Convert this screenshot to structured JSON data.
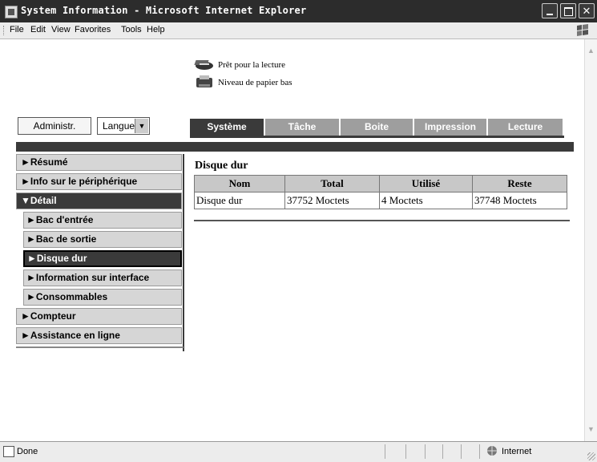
{
  "window": {
    "title": "System Information - Microsoft Internet Explorer"
  },
  "menu": [
    "File",
    "Edit",
    "View",
    "Favorites",
    "Tools",
    "Help"
  ],
  "printer_status": [
    {
      "icon": "printer-ready-icon",
      "text": "Prêt pour la lecture"
    },
    {
      "icon": "printer-low-paper-icon",
      "text": "Niveau de papier bas"
    }
  ],
  "controls": {
    "admin_button": "Administr.",
    "language_select": "Langue"
  },
  "tabs": [
    {
      "label": "Système",
      "active": true
    },
    {
      "label": "Tâche",
      "active": false
    },
    {
      "label": "Boite",
      "active": false
    },
    {
      "label": "Impression",
      "active": false
    },
    {
      "label": "Lecture",
      "active": false
    }
  ],
  "sidebar": {
    "items": [
      {
        "label": "►Résumé"
      },
      {
        "label": "►Info sur le périphérique"
      },
      {
        "label": "▼Détail"
      },
      {
        "label": "►Bac d'entrée"
      },
      {
        "label": "►Bac de sortie"
      },
      {
        "label": "►Disque dur"
      },
      {
        "label": "►Information sur interface"
      },
      {
        "label": "►Consommables"
      },
      {
        "label": "►Compteur"
      },
      {
        "label": "►Assistance en ligne"
      }
    ]
  },
  "main": {
    "section_title": "Disque dur",
    "table": {
      "headers": [
        "Nom",
        "Total",
        "Utilisé",
        "Reste"
      ],
      "rows": [
        [
          "Disque dur",
          "37752 Moctets",
          "4 Moctets",
          "37748 Moctets"
        ]
      ]
    }
  },
  "statusbar": {
    "status": "Done",
    "zone": "Internet"
  }
}
